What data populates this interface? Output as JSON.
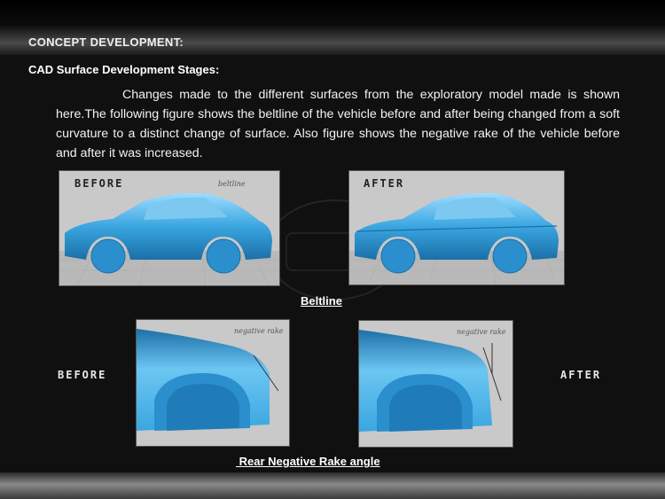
{
  "slide": {
    "section_title": "CONCEPT DEVELOPMENT:",
    "subheading": "CAD Surface Development Stages:",
    "paragraph": "Changes made to the different surfaces from the exploratory model made is shown here.The following figure shows the beltline of the vehicle before and after being changed from a soft curvature to a distinct change of surface. Also figure shows the negative rake of the vehicle before and after it was increased."
  },
  "beltline_figure": {
    "before_label": "BEFORE",
    "after_label": "AFTER",
    "annotation": "beltline",
    "caption": "Beltline"
  },
  "rake_figure": {
    "before_label": "BEFORE",
    "after_label": "AFTER",
    "annotation_left": "negative rake",
    "annotation_right": "negative rake",
    "caption": " Rear Negative Rake angle"
  },
  "colors": {
    "car_blue": "#3aa6e0",
    "panel_grey": "#c9c9c9",
    "background": "#101010"
  }
}
